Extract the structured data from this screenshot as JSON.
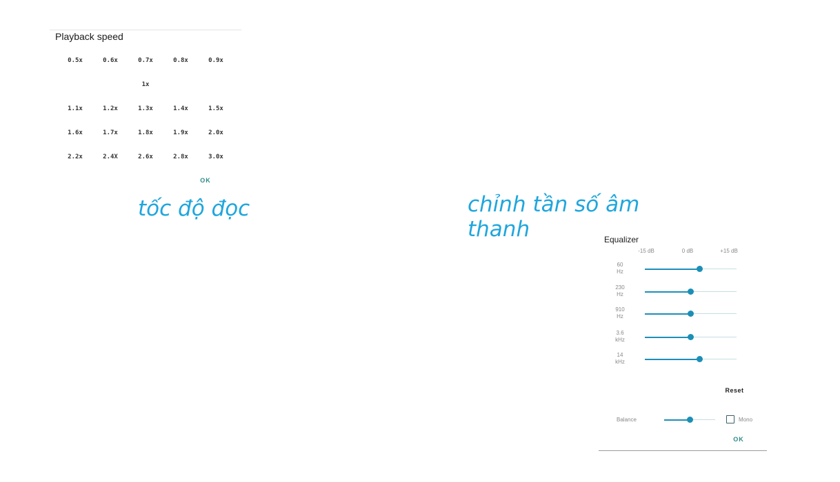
{
  "playback_speed": {
    "title": "Playback speed",
    "rows": [
      [
        "0.5x",
        "0.6x",
        "0.7x",
        "0.8x",
        "0.9x"
      ],
      [
        "1x"
      ],
      [
        "1.1x",
        "1.2x",
        "1.3x",
        "1.4x",
        "1.5x"
      ],
      [
        "1.6x",
        "1.7x",
        "1.8x",
        "1.9x",
        "2.0x"
      ],
      [
        "2.2x",
        "2.4X",
        "2.6x",
        "2.8x",
        "3.0x"
      ]
    ],
    "ok_label": "OK"
  },
  "captions": {
    "speed": "tốc độ đọc",
    "equalizer": "chỉnh tần số âm thanh"
  },
  "equalizer": {
    "title": "Equalizer",
    "db_labels": [
      "-15 dB",
      "0 dB",
      "+15 dB"
    ],
    "bands": [
      {
        "label": "60\nHz",
        "level": 0.6
      },
      {
        "label": "230\nHz",
        "level": 0.5
      },
      {
        "label": "910\nHz",
        "level": 0.5
      },
      {
        "label": "3.6\nkHz",
        "level": 0.5
      },
      {
        "label": "14\nkHz",
        "level": 0.6
      }
    ],
    "reset_label": "Reset",
    "balance_label": "Balance",
    "balance_level": 0.5,
    "mono_label": "Mono",
    "mono_checked": false,
    "ok_label": "OK"
  },
  "colors": {
    "accent": "#1b8fb7",
    "ok_text": "#2b8a86",
    "caption": "#1fa6dd"
  }
}
